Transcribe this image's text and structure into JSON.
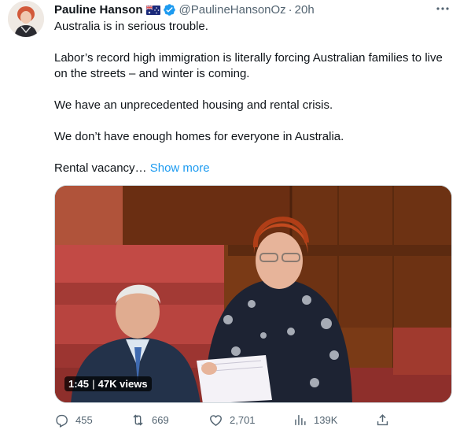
{
  "tweet": {
    "author_name": "Pauline Hanson",
    "handle": "@PaulineHansonOz",
    "separator": "·",
    "time": "20h",
    "paragraphs": [
      "Australia is in serious trouble.",
      "Labor’s record high immigration is literally forcing Australian families to live on the streets – and winter is coming.",
      "We have an unprecedented housing and rental crisis.",
      "We don’t have enough homes for everyone in Australia."
    ],
    "truncated_text": "Rental vacancy…",
    "show_more": "Show more",
    "icons": {
      "flag": "australia-flag-icon",
      "verified": "verified-badge-icon",
      "more": "more-options-icon"
    }
  },
  "media": {
    "duration": "1:45",
    "views": "47K views"
  },
  "actions": {
    "replies": "455",
    "retweets": "669",
    "likes": "2,701",
    "views": "139K"
  },
  "colors": {
    "link": "#1d9bf0",
    "secondary_text": "#536471",
    "verified": "#1d9bf0"
  }
}
